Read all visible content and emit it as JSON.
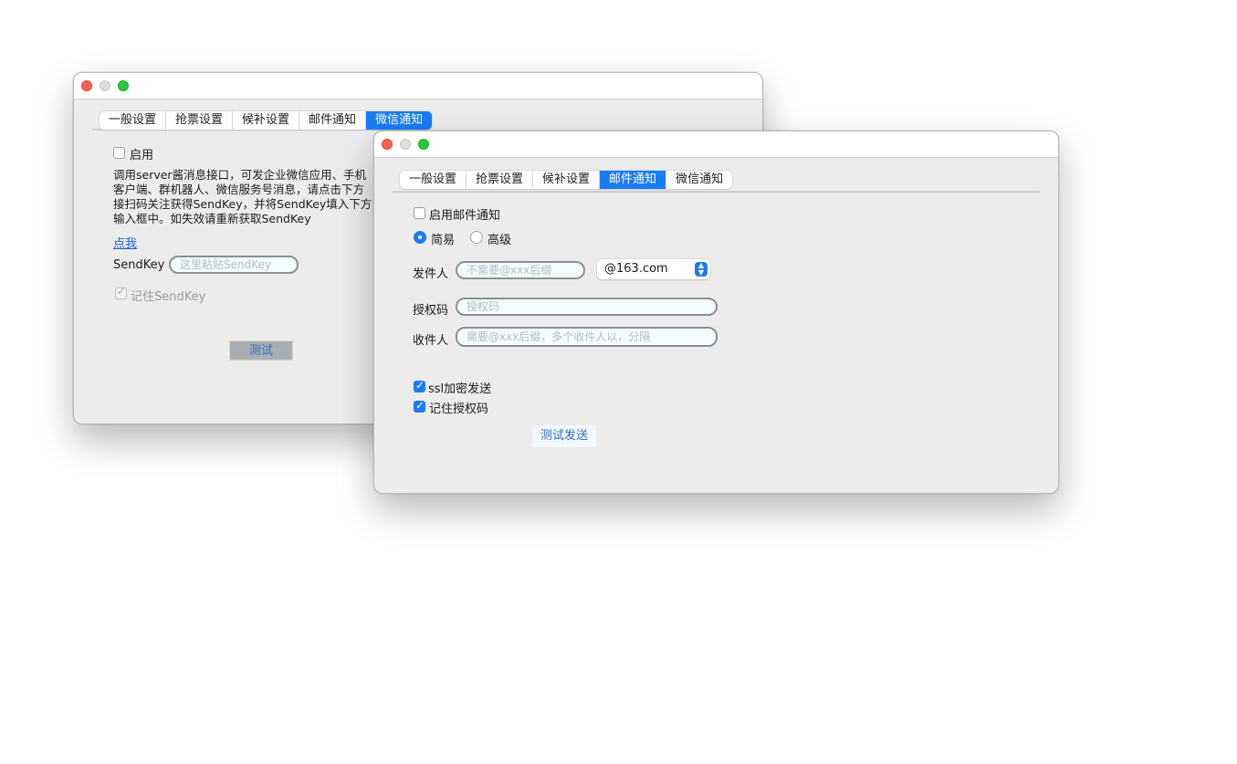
{
  "back_window": {
    "tabs": [
      {
        "label": "一般设置",
        "active": false
      },
      {
        "label": "抢票设置",
        "active": false
      },
      {
        "label": "候补设置",
        "active": false
      },
      {
        "label": "邮件通知",
        "active": false
      },
      {
        "label": "微信通知",
        "active": true
      }
    ],
    "enable_label": "启用",
    "description_lines": [
      "调用server酱消息接口，可发企业微信应用、手机",
      "客户端、群机器人、微信服务号消息，请点击下方",
      "接扫码关注获得SendKey，并将SendKey填入下方",
      "输入框中。如失效请重新获取SendKey"
    ],
    "link_label": "点我",
    "sendkey_label": "SendKey",
    "sendkey_placeholder": "这里粘贴SendKey",
    "remember_label": "记住SendKey",
    "test_button": "测试"
  },
  "front_window": {
    "tabs": [
      {
        "label": "一般设置",
        "active": false
      },
      {
        "label": "抢票设置",
        "active": false
      },
      {
        "label": "候补设置",
        "active": false
      },
      {
        "label": "邮件通知",
        "active": true
      },
      {
        "label": "微信通知",
        "active": false
      }
    ],
    "enable_label": "启用邮件通知",
    "mode_simple": "简易",
    "mode_advanced": "高级",
    "sender_label": "发件人",
    "sender_placeholder": "不需要@xxx后缀",
    "domain_value": "@163.com",
    "auth_label": "授权码",
    "auth_placeholder": "授权码",
    "recipient_label": "收件人",
    "recipient_placeholder": "需要@xxx后缀，多个收件人以，分隔",
    "ssl_label": "ssl加密发送",
    "remember_auth_label": "记住授权码",
    "test_send_button": "测试发送"
  },
  "colors": {
    "accent": "#1a7cf5",
    "window_bg": "#ececec"
  }
}
